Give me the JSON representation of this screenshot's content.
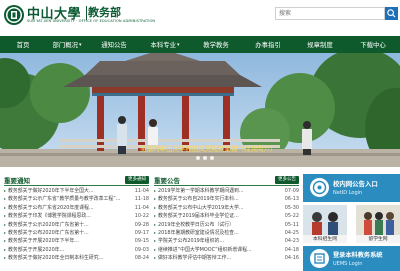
{
  "header": {
    "logo_cn": "中山大學",
    "dept": "教务部",
    "logo_en": "SUN YAT-SEN UNIVERSITY  ·  OFFICE OF EDUCATION ADMINISTRATION",
    "search_placeholder": "搜索",
    "search_icon": "search-icon"
  },
  "nav": {
    "items": [
      {
        "label": "首页",
        "caret": ""
      },
      {
        "label": "部门概况",
        "caret": "▾"
      },
      {
        "label": "通知公告",
        "caret": ""
      },
      {
        "label": "本科专业",
        "caret": "▾"
      },
      {
        "label": "教学教务",
        "caret": ""
      },
      {
        "label": "办事指引",
        "caret": ""
      },
      {
        "label": "规章制度",
        "caret": ""
      },
      {
        "label": "下载中心",
        "caret": ""
      }
    ]
  },
  "banner": {
    "caption": "美丽的中山大学校园风光视频集锦（视频简介）"
  },
  "notices": {
    "title": "重要通知",
    "more": "更多通知",
    "items": [
      {
        "title": "教务部关于做好2020年下半年全国大...",
        "date": "11-04"
      },
      {
        "title": "教务部关于公示广东省“教学质量与教学改革工程”...",
        "date": "11-18"
      },
      {
        "title": "教务部关于公布广东省2020年度课程...",
        "date": "11-04"
      },
      {
        "title": "教务部关于印发《博雅学院课程思政...",
        "date": "10-22"
      },
      {
        "title": "教务部关于公示2020年广东省第十...",
        "date": "09-28"
      },
      {
        "title": "教务部关于公布2020年广东省第十...",
        "date": "09-17"
      },
      {
        "title": "教务部关于开展2020年下半年...",
        "date": "09-15"
      },
      {
        "title": "教务部关于开展2020年...",
        "date": "09-03"
      },
      {
        "title": "教务部关于做好2020年全日制本科生研究...",
        "date": "08-24"
      }
    ]
  },
  "announcements": {
    "title": "重要公告",
    "more": "更多公告",
    "items": [
      {
        "title": "2019学年第一学期本科教学期间遇到...",
        "date": "07-09"
      },
      {
        "title": "教务部关于公布自2019年实行本科...",
        "date": "06-13"
      },
      {
        "title": "教务部关于公布中山大学2019年大学...",
        "date": "05-30"
      },
      {
        "title": "教务部关于2019届本科毕业学位证...",
        "date": "05-22"
      },
      {
        "title": "2019年全校教学日历公布（试行）",
        "date": "05-11"
      },
      {
        "title": "2018年暑期教研室建设情况及检查...",
        "date": "04-25"
      },
      {
        "title": "学院关于公布2019年组织的...",
        "date": "04-23"
      },
      {
        "title": "继续推进“中国大学MOOC”组织新增课程...",
        "date": "04-18"
      },
      {
        "title": "做好本科教学评估中期答辩工作...",
        "date": "04-16"
      }
    ]
  },
  "side": {
    "netid_title": "校内网公告入口",
    "netid_sub": "NetID  Login",
    "tile1_label": "本科招生网",
    "tile2_label": "留学生网",
    "uems_title": "登录本科教务系统",
    "uems_sub": "UEMS  Login"
  },
  "colors": {
    "brand_green": "#0f5a2d",
    "accent_blue": "#2b8cc0",
    "caption_yellow": "#f6dd5c"
  }
}
